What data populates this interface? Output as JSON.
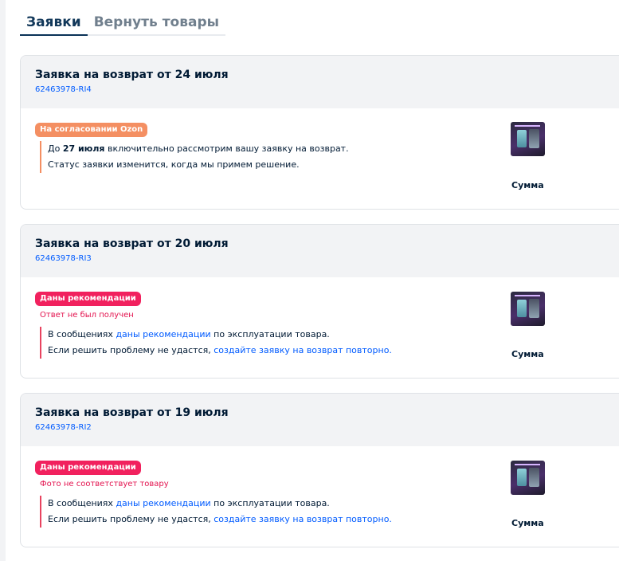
{
  "tabs": [
    {
      "label": "Заявки",
      "active": true
    },
    {
      "label": "Вернуть товары",
      "active": false
    }
  ],
  "cards": [
    {
      "title": "Заявка на возврат от 24 июля",
      "number": "62463978-RI4",
      "badge": "На согласовании Ozon",
      "line1_prefix": "До ",
      "line1_bold": "27 июля",
      "line1_suffix": " включительно рассмотрим вашу заявку на возврат.",
      "line2": "Статус заявки изменится, когда мы примем решение.",
      "sum_label": "Сумма"
    },
    {
      "title": "Заявка на возврат от 20 июля",
      "number": "62463978-RI3",
      "badge": "Даны рекомендации",
      "sub_status": "Ответ не был получен",
      "line1_prefix": "В сообщениях ",
      "line1_link": "даны рекомендации",
      "line1_suffix": " по эксплуатации товара.",
      "line2_prefix": "Если решить проблему не удастся, ",
      "line2_link": "создайте заявку на возврат повторно.",
      "sum_label": "Сумма"
    },
    {
      "title": "Заявка на возврат от 19 июля",
      "number": "62463978-RI2",
      "badge": "Даны рекомендации",
      "sub_status": "Фото не соответствует товару",
      "line1_prefix": "В сообщениях ",
      "line1_link": "даны рекомендации",
      "line1_suffix": " по эксплуатации товара.",
      "line2_prefix": "Если решить проблему не удастся, ",
      "line2_link": "создайте заявку на возврат повторно.",
      "sum_label": "Сумма"
    }
  ],
  "colors": {
    "accent_link": "#005bff",
    "badge_orange": "#f48f62",
    "badge_pink": "#f1215e",
    "status_red": "#e3124e"
  }
}
